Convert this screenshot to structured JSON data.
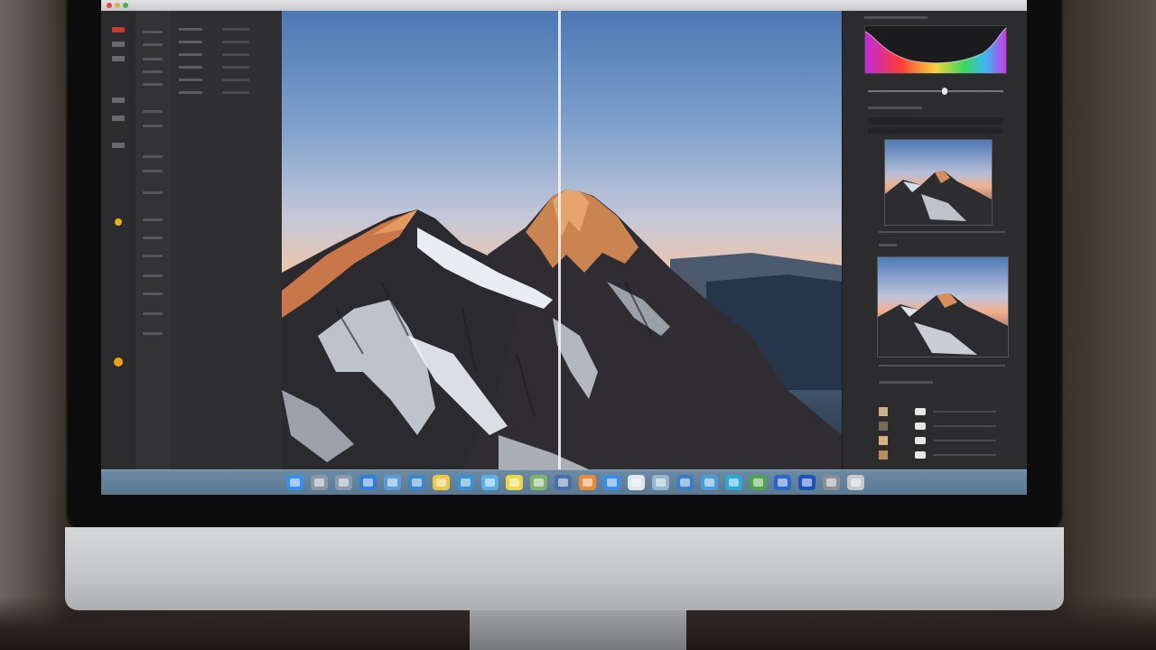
{
  "app": {
    "name": "Photo editor",
    "colors": {
      "accent": "#c53b2f",
      "panel": "#2c2c2e",
      "dock": "#6c8aa3"
    }
  },
  "tools": [
    {
      "icon": "eye-icon"
    },
    {
      "icon": "crop-icon"
    },
    {
      "icon": "brush-icon"
    },
    {
      "icon": "selection-icon"
    },
    {
      "icon": "gradient-icon"
    },
    {
      "icon": "color-picker-icon"
    },
    {
      "icon": "zoom-icon"
    }
  ],
  "histogram": {
    "icon": "histogram-icon"
  },
  "dock": {
    "apps": [
      {
        "icon": "finder-icon",
        "color": "#3a8ee6"
      },
      {
        "icon": "launchpad-icon",
        "color": "#8d98a6"
      },
      {
        "icon": "mail-icon",
        "color": "#8a9bb0"
      },
      {
        "icon": "safari-icon",
        "color": "#2f7fd6"
      },
      {
        "icon": "photos-icon",
        "color": "#5b9bd8"
      },
      {
        "icon": "preview-icon",
        "color": "#3d86c9"
      },
      {
        "icon": "notes-icon",
        "color": "#e9c84a"
      },
      {
        "icon": "calendar-icon",
        "color": "#3b8fd4"
      },
      {
        "icon": "messages-icon",
        "color": "#5ab0e6"
      },
      {
        "icon": "reminders-icon",
        "color": "#e9d94a"
      },
      {
        "icon": "maps-icon",
        "color": "#7fb36b"
      },
      {
        "icon": "music-icon",
        "color": "#4a6fa8"
      },
      {
        "icon": "photo-booth-icon",
        "color": "#e98a3a"
      },
      {
        "icon": "app-store-icon",
        "color": "#3a8ee6"
      },
      {
        "icon": "textedit-icon",
        "color": "#dfe6ee"
      },
      {
        "icon": "contacts-icon",
        "color": "#9ab6cc"
      },
      {
        "icon": "lightroom-icon",
        "color": "#3a7fc4"
      },
      {
        "icon": "finder-window-icon",
        "color": "#4d9bd9"
      },
      {
        "icon": "facetime-icon",
        "color": "#2aa9d6"
      },
      {
        "icon": "numbers-icon",
        "color": "#4fa34a"
      },
      {
        "icon": "xcode-icon",
        "color": "#2a66c8"
      },
      {
        "icon": "folder-icon",
        "color": "#1f52b8"
      },
      {
        "icon": "system-prefs-icon",
        "color": "#8c8f96"
      },
      {
        "icon": "trash-icon",
        "color": "#c6c8cc"
      }
    ]
  }
}
